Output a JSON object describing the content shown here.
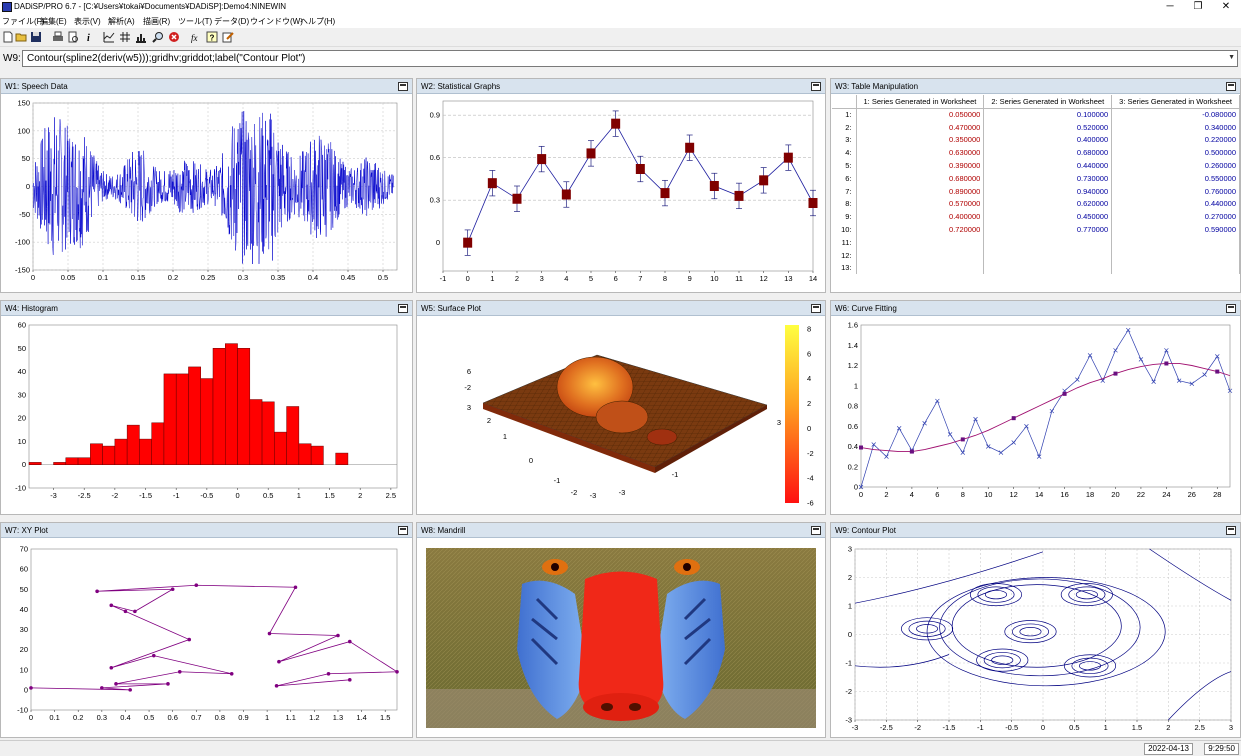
{
  "app": {
    "title": "DADiSP/PRO 6.7 - [C:¥Users¥tokai¥Documents¥DADiSP]:Demo4:NINEWIN",
    "menu": [
      "ファイル(F)",
      "編集(E)",
      "表示(V)",
      "解析(A)",
      "描画(R)",
      "ツール(T)",
      "データ(D)",
      "ウインドウ(W)",
      "ヘルプ(H)"
    ],
    "window_buttons": {
      "min": "─",
      "max": "❐",
      "close": "✕"
    }
  },
  "toolbar": {
    "icons": [
      "new-file-icon",
      "open-folder-icon",
      "save-icon",
      "print-icon",
      "print-preview-icon",
      "info-icon",
      "grid-icon",
      "hash-grid-icon",
      "chart-icon",
      "zoom-icon",
      "stop-icon",
      "function-icon",
      "help-icon",
      "edit-icon"
    ]
  },
  "command": {
    "label": "W9:",
    "value": "Contour(spline2(deriv(w5)));gridhv;griddot;label(\"Contour Plot\")"
  },
  "windows": {
    "w1": {
      "title": "W1: Speech Data"
    },
    "w2": {
      "title": "W2: Statistical Graphs"
    },
    "w3": {
      "title": "W3: Table Manipulation"
    },
    "w4": {
      "title": "W4: Histogram"
    },
    "w5": {
      "title": "W5: Surface Plot"
    },
    "w6": {
      "title": "W6: Curve Fitting"
    },
    "w7": {
      "title": "W7: XY Plot"
    },
    "w8": {
      "title": "W8: Mandrill"
    },
    "w9": {
      "title": "W9: Contour Plot"
    }
  },
  "table": {
    "headers": [
      "",
      "1: Series Generated in Worksheet",
      "2: Series Generated in Worksheet",
      "3: Series Generated in Worksheet"
    ],
    "rows": [
      [
        "1:",
        "0.050000",
        "0.100000",
        "-0.080000"
      ],
      [
        "2:",
        "0.470000",
        "0.520000",
        "0.340000"
      ],
      [
        "3:",
        "0.350000",
        "0.400000",
        "0.220000"
      ],
      [
        "4:",
        "0.630000",
        "0.680000",
        "0.500000"
      ],
      [
        "5:",
        "0.390000",
        "0.440000",
        "0.260000"
      ],
      [
        "6:",
        "0.680000",
        "0.730000",
        "0.550000"
      ],
      [
        "7:",
        "0.890000",
        "0.940000",
        "0.760000"
      ],
      [
        "8:",
        "0.570000",
        "0.620000",
        "0.440000"
      ],
      [
        "9:",
        "0.400000",
        "0.450000",
        "0.270000"
      ],
      [
        "10:",
        "0.720000",
        "0.770000",
        "0.590000"
      ],
      [
        "11:",
        "",
        "",
        ""
      ],
      [
        "12:",
        "",
        "",
        ""
      ],
      [
        "13:",
        "",
        "",
        ""
      ]
    ]
  },
  "status": {
    "date": "2022-04-13",
    "time": "9:29:50"
  },
  "colors": {
    "speech": "#0000cc",
    "stat": "#800000",
    "hist": "#ff0000",
    "xy": "#800080",
    "contour": "#000080"
  },
  "chart_data": [
    {
      "id": "w1",
      "type": "line",
      "xlim": [
        0,
        0.52
      ],
      "ylim": [
        -150,
        150
      ],
      "xticks": [
        "0",
        "0.05",
        "0.1",
        "0.15",
        "0.2",
        "0.25",
        "0.3",
        "0.35",
        "0.4",
        "0.45",
        "0.5"
      ],
      "yticks": [
        "150",
        "100",
        "50",
        "0",
        "-50",
        "-100",
        "-150"
      ]
    },
    {
      "id": "w2",
      "type": "scatter",
      "x": [
        0,
        1,
        2,
        3,
        4,
        5,
        6,
        7,
        8,
        9,
        10,
        11,
        12,
        13,
        14
      ],
      "y": [
        0.0,
        0.42,
        0.31,
        0.59,
        0.34,
        0.63,
        0.84,
        0.52,
        0.35,
        0.67,
        0.4,
        0.33,
        0.44,
        0.6,
        0.28
      ],
      "xlim": [
        -1,
        14
      ],
      "ylim": [
        -0.2,
        1.0
      ],
      "xticks": [
        "-1",
        "0",
        "1",
        "2",
        "3",
        "4",
        "5",
        "6",
        "7",
        "8",
        "9",
        "10",
        "11",
        "12",
        "13",
        "14"
      ],
      "yticks": [
        "0.9",
        "0.6",
        "0.3",
        "0"
      ]
    },
    {
      "id": "w4",
      "type": "bar",
      "bin_start": -3.4,
      "bin_width": 0.2,
      "values": [
        1,
        0,
        1,
        3,
        3,
        9,
        8,
        11,
        17,
        11,
        18,
        39,
        39,
        42,
        37,
        50,
        52,
        50,
        28,
        27,
        14,
        25,
        9,
        8,
        0,
        5
      ],
      "xlim": [
        -3.4,
        2.6
      ],
      "ylim": [
        -10,
        60
      ],
      "xticks": [
        "-3",
        "-2.5",
        "-2",
        "-1.5",
        "-1",
        "-0.5",
        "0",
        "0.5",
        "1",
        "1.5",
        "2",
        "2.5"
      ],
      "yticks": [
        "60",
        "50",
        "40",
        "30",
        "20",
        "10",
        "0",
        "-10"
      ]
    },
    {
      "id": "w5",
      "type": "area",
      "zlim": [
        -6,
        8
      ],
      "colorbar_ticks": [
        "8",
        "6",
        "4",
        "2",
        "0",
        "-2",
        "-4",
        "-6"
      ],
      "z_labels": [
        "6",
        "-2",
        "3"
      ],
      "y_labels": [
        "2",
        "1",
        "0",
        "-1",
        "-2",
        "-3"
      ],
      "x_labels": [
        "3",
        "-1",
        "-3"
      ]
    },
    {
      "id": "w6",
      "type": "line",
      "x": [
        0,
        1,
        2,
        3,
        4,
        5,
        6,
        7,
        8,
        9,
        10,
        11,
        12,
        13,
        14,
        15,
        16,
        17,
        18,
        19,
        20,
        21,
        22,
        23,
        24,
        25,
        26,
        27,
        28,
        29
      ],
      "y": [
        0.0,
        0.42,
        0.3,
        0.58,
        0.36,
        0.63,
        0.85,
        0.52,
        0.34,
        0.67,
        0.4,
        0.34,
        0.44,
        0.6,
        0.3,
        0.75,
        0.95,
        1.06,
        1.3,
        1.05,
        1.35,
        1.55,
        1.26,
        1.04,
        1.35,
        1.05,
        1.02,
        1.11,
        1.29,
        0.95
      ],
      "fit": [
        0.39,
        0.37,
        0.36,
        0.35,
        0.35,
        0.37,
        0.4,
        0.43,
        0.47,
        0.51,
        0.56,
        0.62,
        0.68,
        0.74,
        0.8,
        0.86,
        0.92,
        0.98,
        1.03,
        1.07,
        1.12,
        1.16,
        1.19,
        1.21,
        1.22,
        1.22,
        1.2,
        1.17,
        1.14,
        1.1
      ],
      "xlim": [
        0,
        29
      ],
      "ylim": [
        0,
        1.6
      ],
      "xticks": [
        "0",
        "2",
        "4",
        "6",
        "8",
        "10",
        "12",
        "14",
        "16",
        "18",
        "20",
        "22",
        "24",
        "26",
        "28"
      ],
      "yticks": [
        "1.6",
        "1.4",
        "1.2",
        "1",
        "0.8",
        "0.6",
        "0.4",
        "0.2",
        "0"
      ]
    },
    {
      "id": "w7",
      "type": "scatter",
      "x": [
        0.0,
        0.42,
        0.3,
        0.58,
        0.36,
        0.63,
        0.85,
        0.52,
        0.34,
        0.67,
        0.4,
        0.34,
        0.44,
        0.6,
        0.28,
        0.7,
        1.12,
        1.01,
        1.3,
        1.05,
        1.35,
        1.55,
        1.26,
        1.04,
        1.35
      ],
      "y": [
        1,
        0,
        1,
        3,
        3,
        9,
        8,
        17,
        11,
        25,
        39,
        42,
        39,
        50,
        49,
        52,
        51,
        28,
        27,
        14,
        24,
        9,
        8,
        2,
        5
      ],
      "xlim": [
        0,
        1.55
      ],
      "ylim": [
        -10,
        70
      ],
      "xticks": [
        "0",
        "0.1",
        "0.2",
        "0.3",
        "0.4",
        "0.5",
        "0.6",
        "0.7",
        "0.8",
        "0.9",
        "1",
        "1.1",
        "1.2",
        "1.3",
        "1.4",
        "1.5"
      ],
      "yticks": [
        "70",
        "60",
        "50",
        "40",
        "30",
        "20",
        "10",
        "0",
        "-10"
      ]
    },
    {
      "id": "w9",
      "type": "line",
      "xlim": [
        -3,
        3
      ],
      "ylim": [
        -3,
        3
      ],
      "xticks": [
        "-3",
        "-2.5",
        "-2",
        "-1.5",
        "-1",
        "-0.5",
        "0",
        "0.5",
        "1",
        "1.5",
        "2",
        "2.5",
        "3"
      ],
      "yticks": [
        "3",
        "2",
        "1",
        "0",
        "-1",
        "-2",
        "-3"
      ]
    }
  ]
}
